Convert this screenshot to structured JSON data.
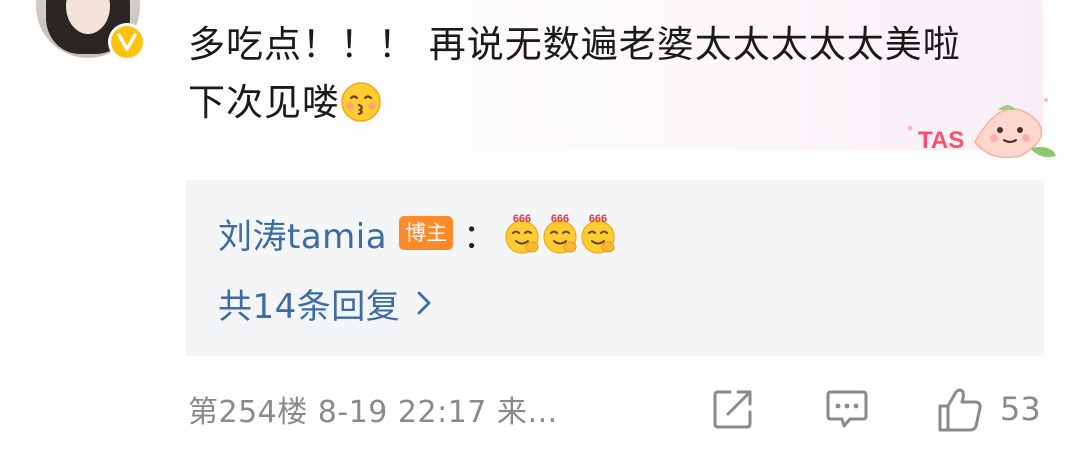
{
  "comment": {
    "text": "多吃点！！！ 再说无数遍老婆太太太太太美啦 下次见喽",
    "emoji": "kiss-face-emoji"
  },
  "bubble_decoration": {
    "label": "TAS"
  },
  "reply_preview": {
    "author": "刘涛tamia",
    "badge": "博主",
    "separator": "：",
    "emojis": [
      "666-emoji",
      "666-emoji",
      "666-emoji"
    ],
    "emoji_label": "666",
    "more_link": "共14条回复"
  },
  "footer": {
    "meta": "第254楼 8-19 22:17 来…",
    "like_count": "53"
  },
  "colors": {
    "link": "#3d6ba6",
    "badge": "#ff8a2c",
    "verified": "#ffc20e",
    "muted": "#8a8a8a",
    "reply_bg": "#f4f5f7"
  }
}
